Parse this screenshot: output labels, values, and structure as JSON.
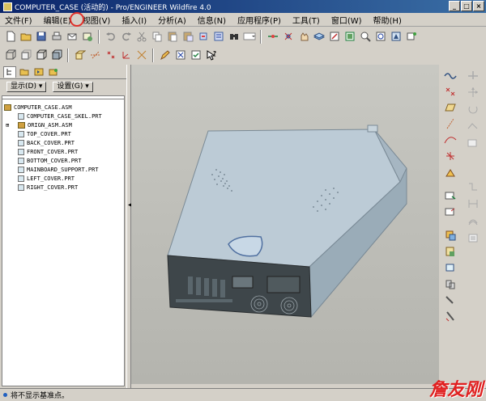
{
  "window": {
    "title": "COMPUTER_CASE (活动的) - Pro/ENGINEER Wildfire 4.0",
    "controls": [
      "_",
      "□",
      "×"
    ]
  },
  "menu": [
    "文件(F)",
    "编辑(E)",
    "视图(V)",
    "插入(I)",
    "分析(A)",
    "信息(N)",
    "应用程序(P)",
    "工具(T)",
    "窗口(W)",
    "帮助(H)"
  ],
  "panel": {
    "show_label": "显示(D) ▾",
    "settings_label": "设置(G) ▾"
  },
  "tree": {
    "root": "COMPUTER_CASE.ASM",
    "items": [
      {
        "label": "COMPUTER_CASE_SKEL.PRT",
        "expand": "",
        "kind": "part"
      },
      {
        "label": "ORIGN_ASM.ASM",
        "expand": "⊞",
        "kind": "asm"
      },
      {
        "label": "TOP_COVER.PRT",
        "expand": "",
        "kind": "part"
      },
      {
        "label": "BACK_COVER.PRT",
        "expand": "",
        "kind": "part"
      },
      {
        "label": "FRONT_COVER.PRT",
        "expand": "",
        "kind": "part"
      },
      {
        "label": "BOTTOM_COVER.PRT",
        "expand": "",
        "kind": "part"
      },
      {
        "label": "MAINBOARD_SUPPORT.PRT",
        "expand": "",
        "kind": "part"
      },
      {
        "label": "LEFT_COVER.PRT",
        "expand": "",
        "kind": "part"
      },
      {
        "label": "RIGHT_COVER.PRT",
        "expand": "",
        "kind": "part"
      }
    ]
  },
  "status": {
    "message": "将不显示基准点。"
  },
  "watermark": "詹友刚",
  "colors": {
    "model_top": "#b8c8d4",
    "model_side": "#98aab6",
    "model_dark": "#3c4448",
    "highlight": "#e0302a"
  }
}
